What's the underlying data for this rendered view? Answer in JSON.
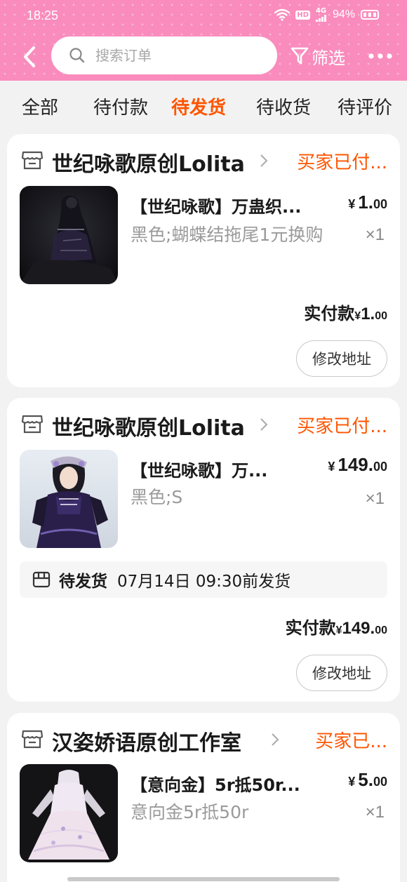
{
  "status_bar": {
    "time": "18:25",
    "hd": "HD",
    "network": "4G",
    "battery_percent": "94%"
  },
  "header": {
    "back_icon": "chevron-left-icon",
    "search": {
      "placeholder": "搜索订单",
      "value": ""
    },
    "filter_label": "筛选",
    "filter_icon": "funnel-icon",
    "more_icon": "more-dots-icon",
    "bg_color": "#f98cbd"
  },
  "tabs": [
    {
      "label": "全部",
      "active": false
    },
    {
      "label": "待付款",
      "active": false
    },
    {
      "label": "待发货",
      "active": true
    },
    {
      "label": "待收货",
      "active": false
    },
    {
      "label": "待评价",
      "active": false
    }
  ],
  "accent_color": "#ff5500",
  "orders": [
    {
      "shop_name": "世纪咏歌原创Lolita",
      "status": "买家已付...",
      "product": {
        "title": "【世纪咏歌】万蛊织...",
        "sku": "黑色;蝴蝶结拖尾1元换购",
        "price_currency": "¥",
        "price_int": "1.",
        "price_dec": "00",
        "qty": "×1"
      },
      "paid_label": "实付款",
      "paid_currency": "¥",
      "paid_int": "1.",
      "paid_dec": "00",
      "action": "修改地址"
    },
    {
      "shop_name": "世纪咏歌原创Lolita",
      "status": "买家已付...",
      "product": {
        "title": "【世纪咏歌】万...",
        "sku": "黑色;S",
        "price_currency": "¥",
        "price_int": "149.",
        "price_dec": "00",
        "qty": "×1"
      },
      "shipping": {
        "status": "待发货",
        "deadline": "07月14日 09:30前发货"
      },
      "paid_label": "实付款",
      "paid_currency": "¥",
      "paid_int": "149.",
      "paid_dec": "00",
      "action": "修改地址"
    },
    {
      "shop_name": "汉姿娇语原创工作室",
      "status": "买家已...",
      "product": {
        "title": "【意向金】5r抵50r...",
        "sku": "意向金5r抵50r",
        "price_currency": "¥",
        "price_int": "5.",
        "price_dec": "00",
        "qty": "×1"
      }
    }
  ]
}
